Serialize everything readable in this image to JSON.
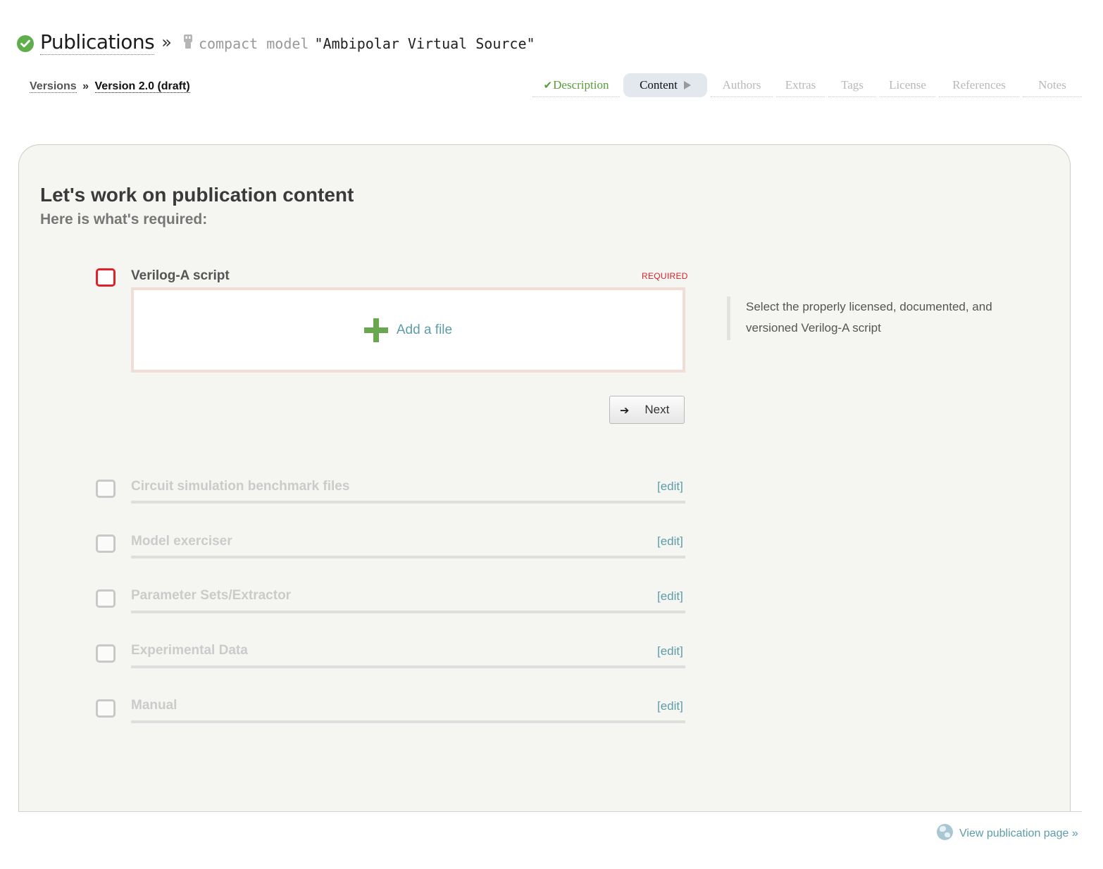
{
  "header": {
    "publications_label": "Publications",
    "separator": "»",
    "type_label": "compact model",
    "title": "\"Ambipolar Virtual Source\""
  },
  "breadcrumb": {
    "versions_label": "Versions",
    "separator": "»",
    "current_label": "Version 2.0 (draft)"
  },
  "steps": [
    {
      "label": "Description",
      "state": "done"
    },
    {
      "label": "Content",
      "state": "current"
    },
    {
      "label": "Authors",
      "state": "pending"
    },
    {
      "label": "Extras",
      "state": "pending"
    },
    {
      "label": "Tags",
      "state": "pending"
    },
    {
      "label": "License",
      "state": "pending"
    },
    {
      "label": "References",
      "state": "pending"
    },
    {
      "label": "Notes",
      "state": "pending"
    }
  ],
  "main": {
    "title": "Let's work on publication content",
    "subtitle": "Here is what's required:",
    "active_item": {
      "title": "Verilog-A script",
      "required_label": "REQUIRED",
      "add_file_label": "Add a file",
      "hint": "Select the properly licensed, documented, and versioned Verilog-A script",
      "next_label": "Next"
    },
    "items": [
      {
        "title": "Circuit simulation benchmark files",
        "edit_label": "[edit]"
      },
      {
        "title": "Model exerciser",
        "edit_label": "[edit]"
      },
      {
        "title": "Parameter Sets/Extractor",
        "edit_label": "[edit]"
      },
      {
        "title": "Experimental Data",
        "edit_label": "[edit]"
      },
      {
        "title": "Manual",
        "edit_label": "[edit]"
      }
    ]
  },
  "footer": {
    "view_page_label": "View publication page »",
    "icon": "globe-icon"
  },
  "colors": {
    "accent_green": "#5fae4c",
    "link_teal": "#5d9ca8",
    "required_red": "#e0202a",
    "panel_bg": "#f5f6f2"
  }
}
